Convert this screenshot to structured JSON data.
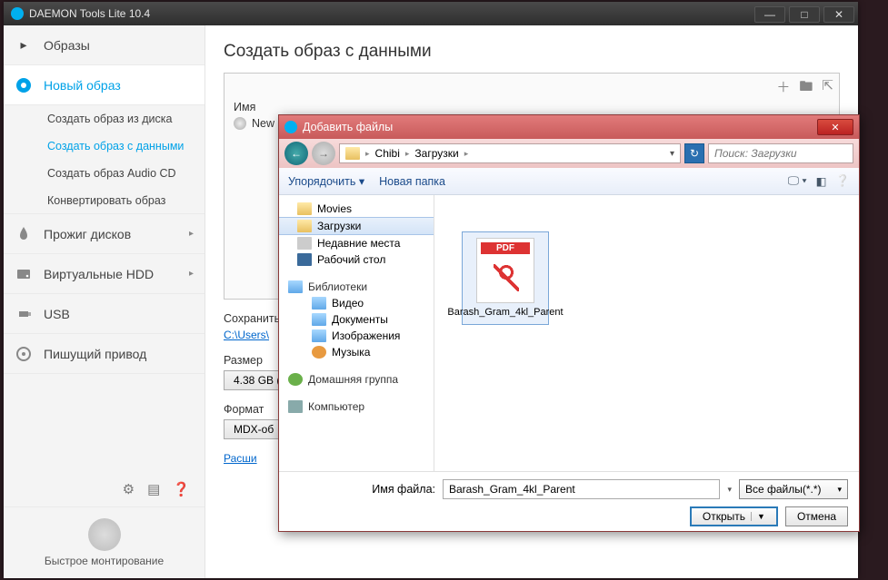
{
  "app": {
    "title": "DAEMON Tools Lite 10.4"
  },
  "sidebar": {
    "items": [
      {
        "label": "Образы",
        "icon": "chevron"
      },
      {
        "label": "Новый образ",
        "icon": "disc",
        "active": true
      },
      {
        "label": "Создать образ из диска",
        "sub": true
      },
      {
        "label": "Создать образ с данными",
        "sub": true,
        "selected": true
      },
      {
        "label": "Создать образ Audio CD",
        "sub": true
      },
      {
        "label": "Конвертировать образ",
        "sub": true
      },
      {
        "label": "Прожиг дисков",
        "icon": "flame"
      },
      {
        "label": "Виртуальные HDD",
        "icon": "hdd"
      },
      {
        "label": "USB",
        "icon": "usb"
      },
      {
        "label": "Пишущий привод",
        "icon": "drive"
      }
    ],
    "mount_label": "Быстрое монтирование"
  },
  "main": {
    "heading": "Создать образ с данными",
    "name_col": "Имя",
    "new_image": "New",
    "save_label": "Сохранить как:",
    "save_path": "C:\\Users\\",
    "size_label": "Размер",
    "size_value": "4.38 GB (",
    "format_label": "Формат",
    "format_value": "MDX-об",
    "advanced": "Расши"
  },
  "dialog": {
    "title": "Добавить файлы",
    "crumbs": [
      "Chibi",
      "Загрузки"
    ],
    "search_placeholder": "Поиск: Загрузки",
    "organize": "Упорядочить",
    "new_folder": "Новая папка",
    "tree": {
      "fav": [
        {
          "label": "Movies",
          "icon": "folder"
        },
        {
          "label": "Загрузки",
          "icon": "folder",
          "selected": true
        },
        {
          "label": "Недавние места",
          "icon": "recent"
        },
        {
          "label": "Рабочий стол",
          "icon": "mon"
        }
      ],
      "lib_header": "Библиотеки",
      "libs": [
        {
          "label": "Видео",
          "icon": "lib"
        },
        {
          "label": "Документы",
          "icon": "lib"
        },
        {
          "label": "Изображения",
          "icon": "lib"
        },
        {
          "label": "Музыка",
          "icon": "mus"
        }
      ],
      "homegroup": "Домашняя группа",
      "computer": "Компьютер"
    },
    "files": [
      {
        "name": "Barash_Gram_4kl_Parent",
        "type": "pdf"
      }
    ],
    "file_name_label": "Имя файла:",
    "file_name_value": "Barash_Gram_4kl_Parent",
    "filter": "Все файлы(*.*)",
    "open": "Открыть",
    "cancel": "Отмена"
  }
}
